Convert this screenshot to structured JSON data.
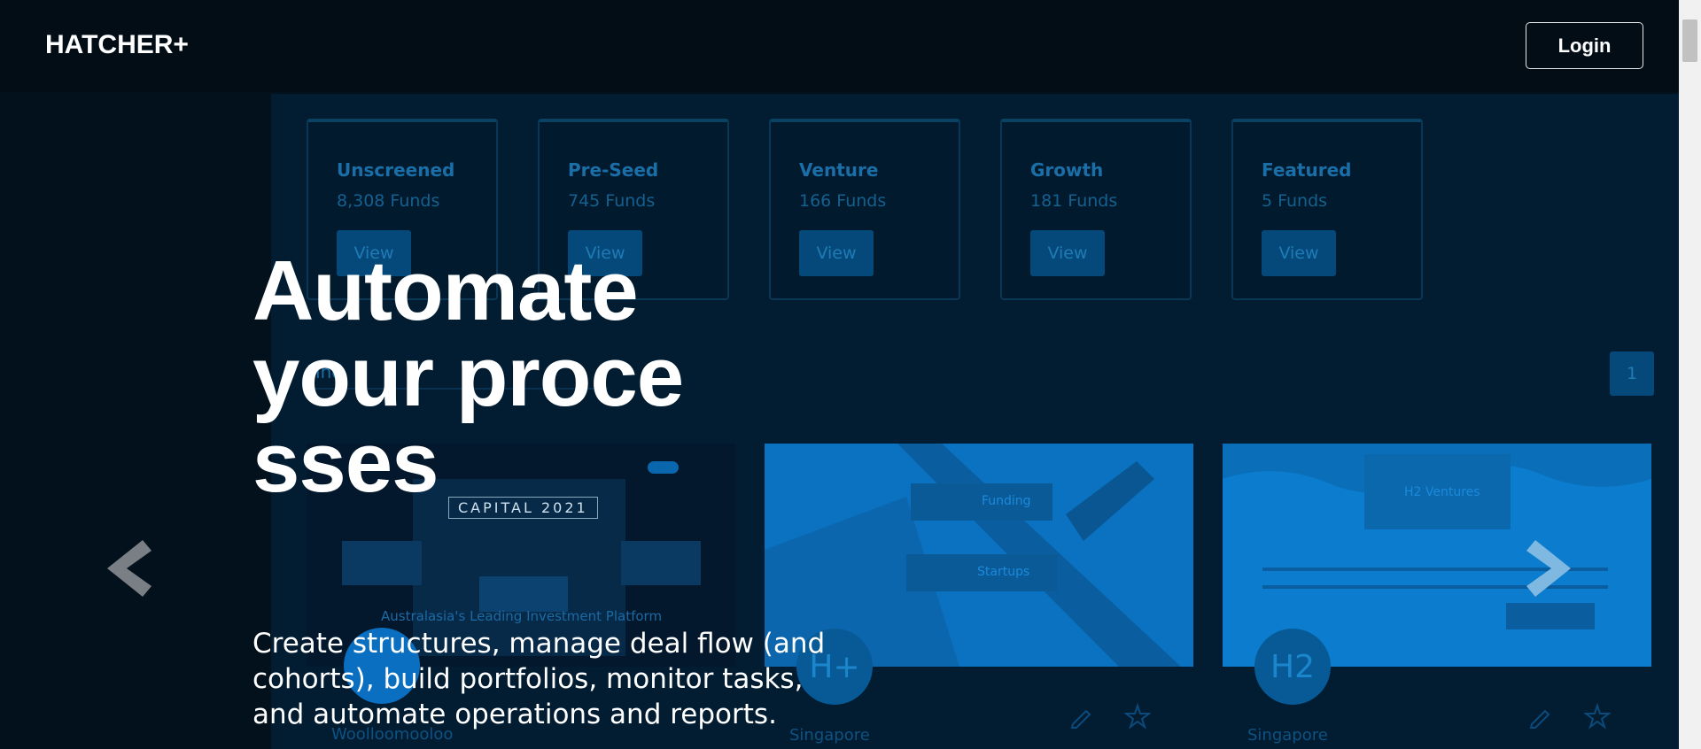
{
  "header": {
    "logo": "HATCHER+",
    "login_label": "Login"
  },
  "background_dashboard": {
    "fund_categories": [
      {
        "title": "Unscreened",
        "count": "8,308 Funds",
        "button": "View"
      },
      {
        "title": "Pre-Seed",
        "count": "745 Funds",
        "button": "View"
      },
      {
        "title": "Venture",
        "count": "166 Funds",
        "button": "View"
      },
      {
        "title": "Growth",
        "count": "181 Funds",
        "button": "View"
      },
      {
        "title": "Featured",
        "count": "5 Funds",
        "button": "View"
      }
    ],
    "find_label": "Find",
    "page_number": "1",
    "tiles": [
      {
        "banner": "CAPITAL 2021",
        "caption": "Australasia's Leading Investment Platform",
        "location": "Woolloomooloo"
      },
      {
        "label_a": "Funding",
        "label_b": "Startups",
        "logo": "H+",
        "location": "Singapore"
      },
      {
        "label_a": "H2 Ventures",
        "logo": "H2",
        "location": "Singapore"
      }
    ]
  },
  "hero": {
    "title": "Automate your processes",
    "subtitle": "Create structures, manage deal flow (and cohorts), build portfolios, monitor tasks, and automate operations and reports."
  },
  "carousel": {
    "prev_icon": "chevron-left-icon",
    "next_icon": "chevron-right-icon"
  },
  "colors": {
    "background": "#03111c",
    "accent": "#0b7ccd",
    "text": "#ffffff"
  }
}
